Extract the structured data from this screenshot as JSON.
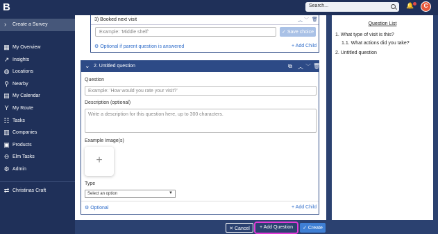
{
  "topbar": {
    "logo": "B",
    "search_placeholder": "Search...",
    "avatar_initial": "C"
  },
  "sidebar": {
    "active_item": "Create a Survey",
    "items": [
      {
        "label": "My Overview",
        "icon": "grid-icon"
      },
      {
        "label": "Insights",
        "icon": "trend-icon"
      },
      {
        "label": "Locations",
        "icon": "globe-icon"
      },
      {
        "label": "Nearby",
        "icon": "pin-icon"
      },
      {
        "label": "My Calendar",
        "icon": "calendar-icon"
      },
      {
        "label": "My Route",
        "icon": "route-icon"
      },
      {
        "label": "Tasks",
        "icon": "tasks-icon"
      },
      {
        "label": "Companies",
        "icon": "building-icon"
      },
      {
        "label": "Products",
        "icon": "product-icon"
      },
      {
        "label": "Elm Tasks",
        "icon": "minus-circle-icon"
      },
      {
        "label": "Admin",
        "icon": "gear-icon"
      }
    ],
    "workspace": "Christinas Craft"
  },
  "choice_card": {
    "title": "3) Booked next visit",
    "input_placeholder": "Example: 'Middle shelf'",
    "save_label": "Save choice",
    "optional_label": "Optional if parent question is answered",
    "add_child_label": "Add Child"
  },
  "question_card": {
    "title": "2. Untitled question",
    "question_label": "Question",
    "question_placeholder": "Example: 'How would you rate your visit?'",
    "description_label": "Description (optional)",
    "description_placeholder": "Write a description for this question here, up to 300 characters.",
    "image_label": "Example Image(s)",
    "type_label": "Type",
    "type_selected": "Select an option",
    "optional_label": "Optional",
    "add_child_label": "Add Child"
  },
  "question_list": {
    "title": "Question List",
    "items": [
      "1. What type of visit is this?",
      "1.1. What actions did you take?",
      "2. Untitled question"
    ]
  },
  "footer": {
    "cancel_label": "Cancel",
    "add_question_label": "Add Question",
    "create_label": "Create"
  }
}
